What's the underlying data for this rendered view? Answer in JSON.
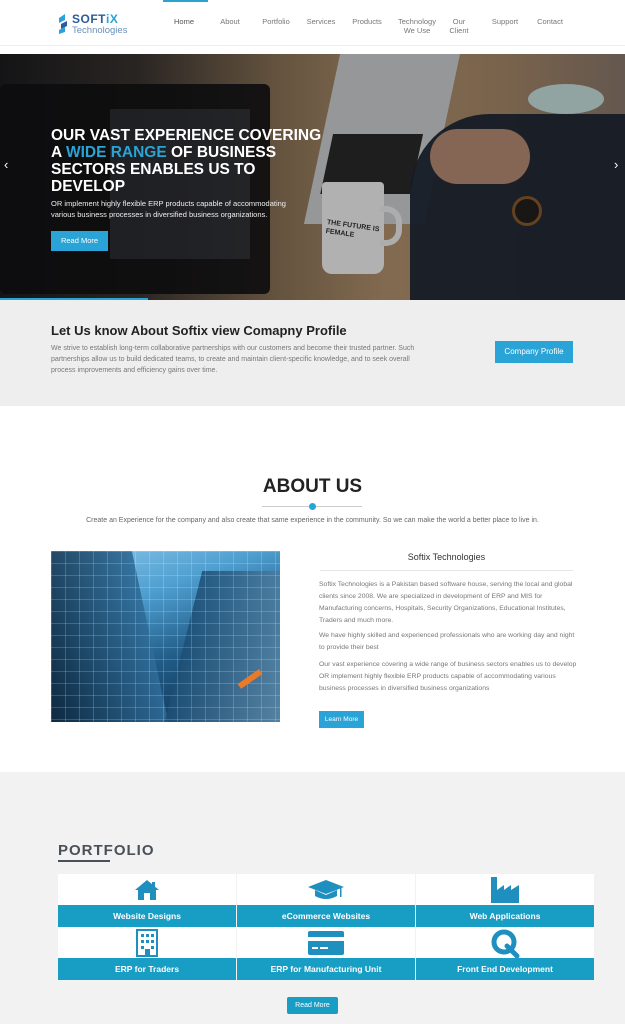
{
  "brand": {
    "name_part1": "SOFT",
    "name_part2": "iX",
    "sub": "Technologies"
  },
  "nav": {
    "items": [
      {
        "label": "Home"
      },
      {
        "label": "About"
      },
      {
        "label": "Portfolio"
      },
      {
        "label": "Services"
      },
      {
        "label": "Products"
      },
      {
        "label": "Technology We Use"
      },
      {
        "label": "Our Client"
      },
      {
        "label": "Support"
      },
      {
        "label": "Contact"
      }
    ],
    "active": "Home"
  },
  "hero": {
    "title_part1": "OUR VAST EXPERIENCE COVERING A ",
    "title_accent": "WIDE RANGE",
    "title_part2": " OF BUSINESS SECTORS ENABLES US TO DEVELOP",
    "text": "OR implement highly flexible ERP products capable of accommodating various business processes in diversified business organizations.",
    "button": "Read More",
    "mug_text": "THE FUTURE IS FEMALE",
    "prev_arrow": "‹",
    "next_arrow": "›"
  },
  "profile": {
    "title": "Let Us know About Softix view Comapny Profile",
    "text": "We strive to establish long-term collaborative partnerships with our customers and become their trusted partner. Such partnerships allow us to build dedicated teams, to create and maintain client-specific knowledge, and to seek overall process improvements and efficiency gains over time.",
    "button": "Company Profile"
  },
  "about": {
    "title": "ABOUT US",
    "subtitle": "Create an Experience for the company and also create that same experience in the community. So we can make the world a better place to live in.",
    "company": "Softix Technologies",
    "paragraphs": [
      "Softix Technologies is a Pakistan based software house, serving the local and global clients since 2008. We are specialized in development of ERP and MIS for Manufacturing concerns, Hospitals, Security Organizations, Educational Institutes, Traders and much more.",
      "We have highly skilled and experienced professionals who are working day and night to provide their best",
      "Our vast experience covering a wide range of business sectors enables us to develop OR implement highly flexible ERP products capable of accommodating various business processes in diversified business organizations"
    ],
    "button": "Learn More"
  },
  "portfolio": {
    "title": "PORTFOLIO",
    "items": [
      {
        "label": "Website Designs",
        "icon": "home-icon"
      },
      {
        "label": "eCommerce Websites",
        "icon": "graduation-cap-icon"
      },
      {
        "label": "Web Applications",
        "icon": "factory-icon"
      },
      {
        "label": "ERP for Traders",
        "icon": "building-icon"
      },
      {
        "label": "ERP for Manufacturing Unit",
        "icon": "credit-card-icon"
      },
      {
        "label": "Front End Development",
        "icon": "search-q-icon"
      }
    ],
    "button": "Read More"
  },
  "colors": {
    "accent": "#2aa3d6",
    "portfolio_blue": "#189dc4",
    "icon_blue": "#1f8fc0"
  }
}
